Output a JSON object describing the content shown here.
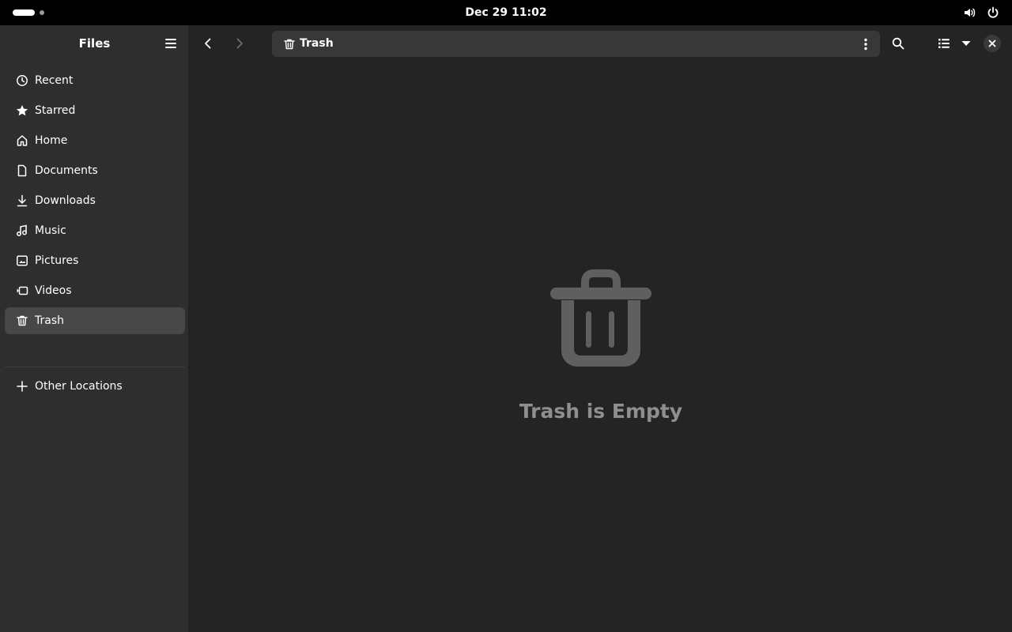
{
  "topbar": {
    "clock": "Dec 29  11:02",
    "icons": [
      "volume-icon",
      "power-icon"
    ]
  },
  "sidebar": {
    "title": "Files",
    "items": [
      {
        "label": "Recent",
        "icon": "clock-icon"
      },
      {
        "label": "Starred",
        "icon": "star-icon"
      },
      {
        "label": "Home",
        "icon": "home-icon"
      },
      {
        "label": "Documents",
        "icon": "document-icon"
      },
      {
        "label": "Downloads",
        "icon": "download-icon"
      },
      {
        "label": "Music",
        "icon": "music-icon"
      },
      {
        "label": "Pictures",
        "icon": "picture-icon"
      },
      {
        "label": "Videos",
        "icon": "video-icon"
      },
      {
        "label": "Trash",
        "icon": "trash-icon",
        "selected": true
      }
    ],
    "other_locations": {
      "label": "Other Locations",
      "icon": "plus-icon"
    }
  },
  "pathbar": {
    "location": "Trash",
    "icon": "trash-icon"
  },
  "empty_state": {
    "title": "Trash is Empty",
    "icon": "trash-icon"
  },
  "colors": {
    "sidebar_bg": "#2e2e2e",
    "main_bg": "#242424",
    "selected_bg": "#474747",
    "pathbar_bg": "#383838",
    "empty_text": "#8f8f8f"
  }
}
